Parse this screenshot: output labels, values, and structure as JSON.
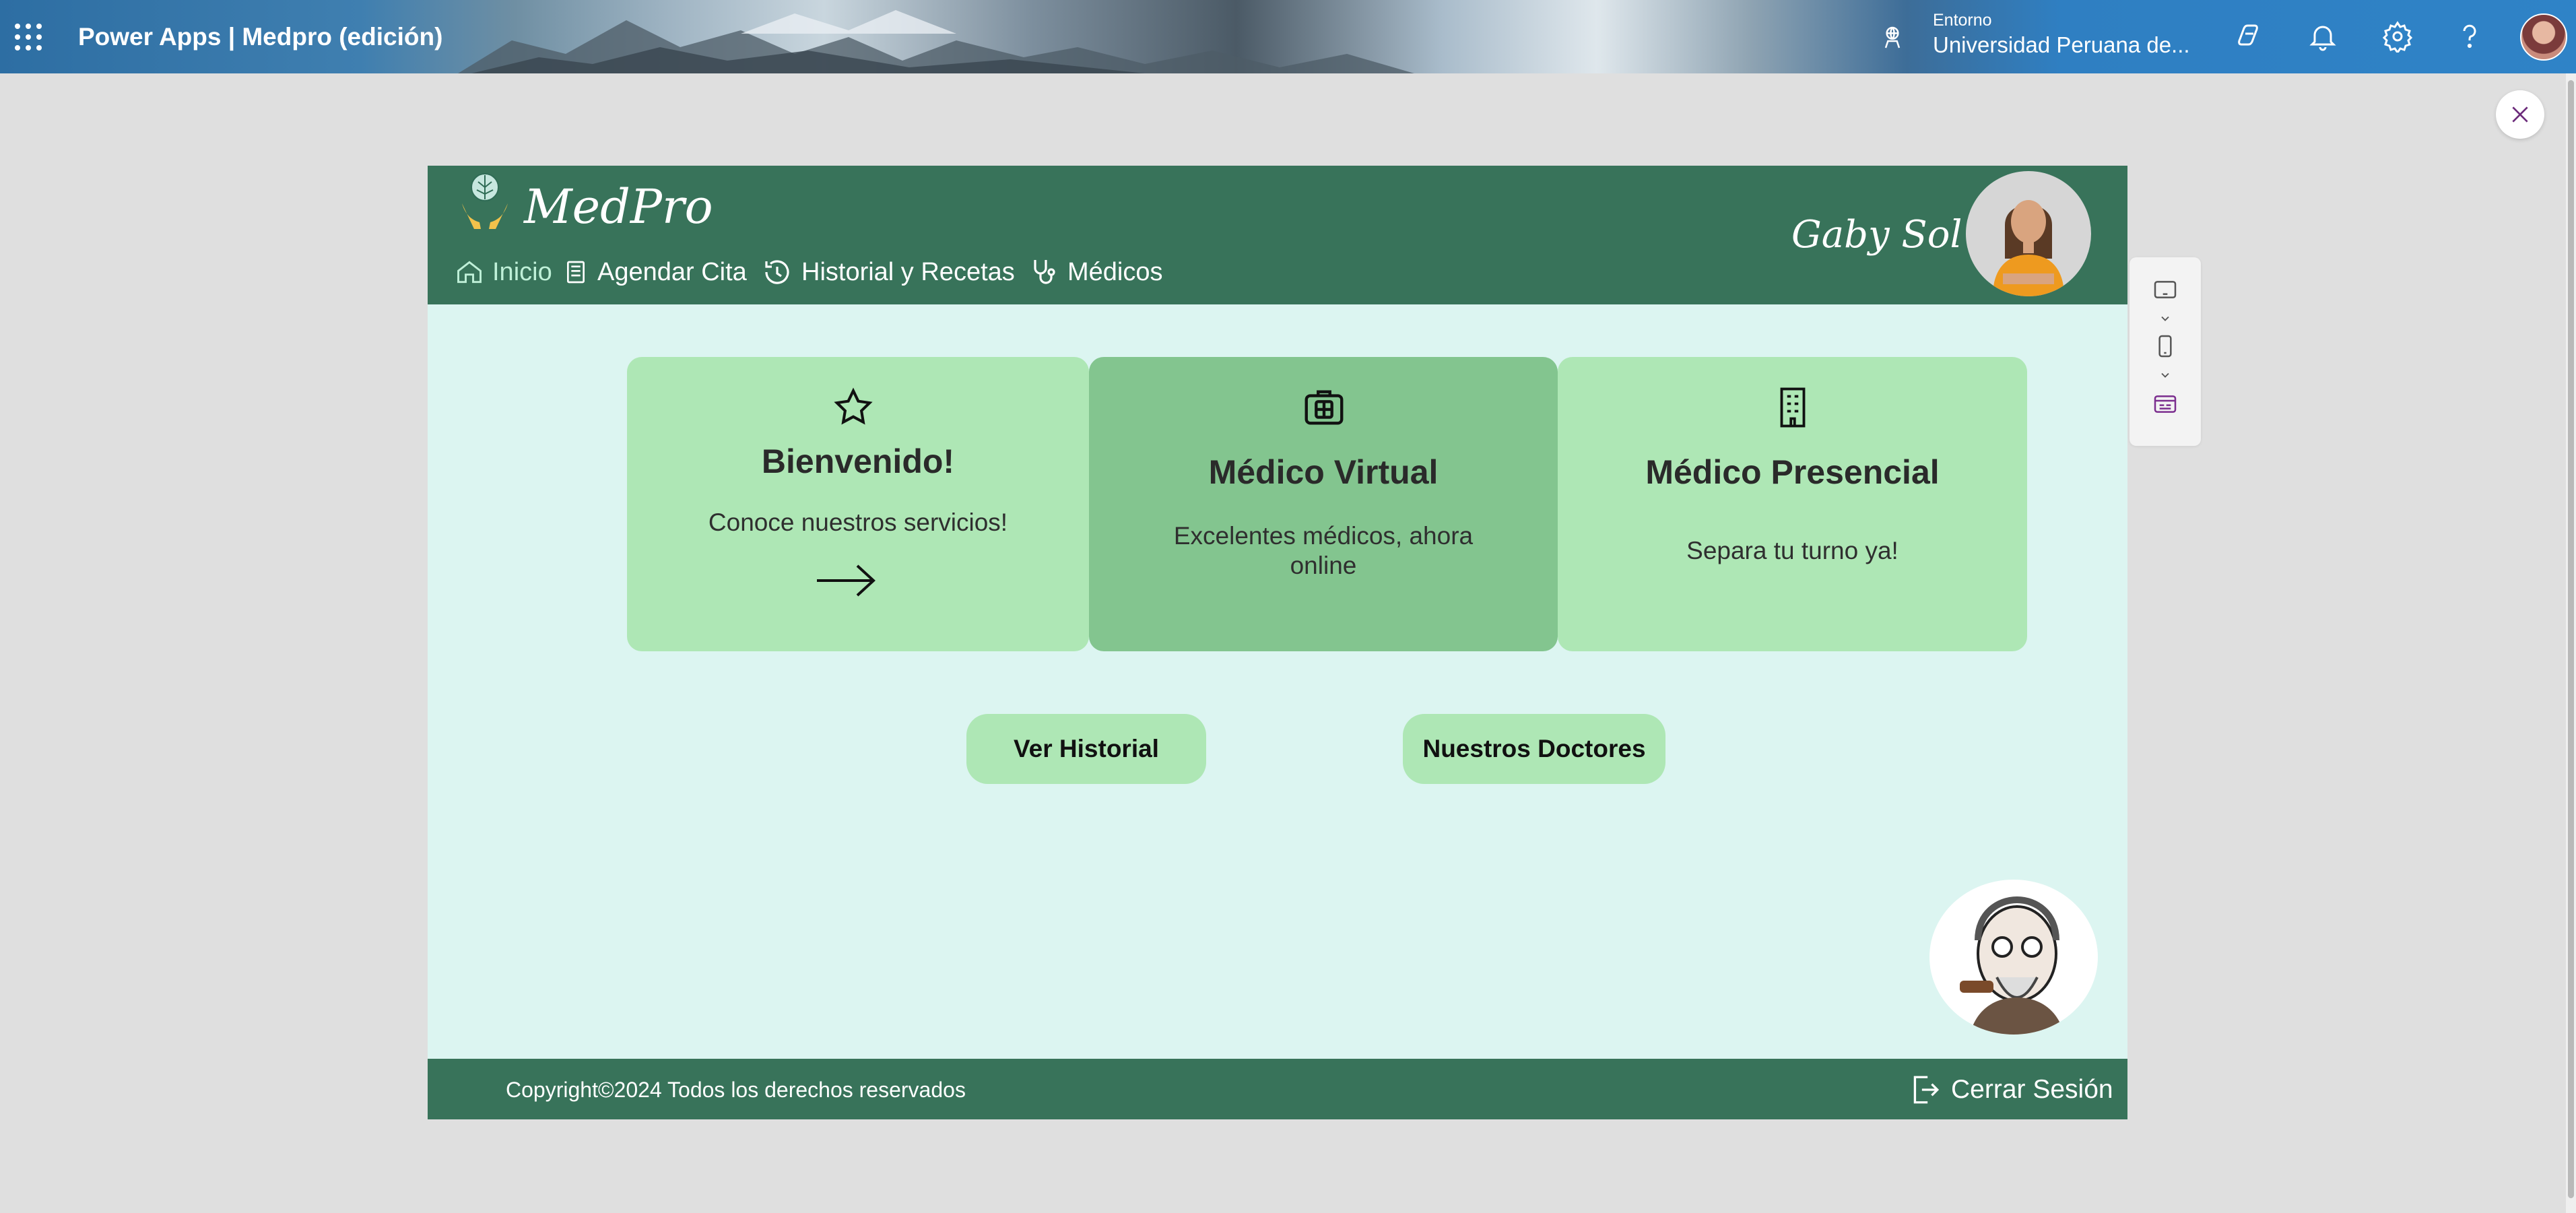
{
  "topbar": {
    "app_title": "Power Apps  |  Medpro (edición)",
    "environment_label": "Entorno",
    "environment_value": "Universidad Peruana de...",
    "icons": [
      "waffle-icon",
      "environment-icon",
      "copilot-icon",
      "bell-icon",
      "gear-icon",
      "help-icon",
      "user-avatar"
    ]
  },
  "app": {
    "brand": "MedPro",
    "user_name": "Gaby Sol",
    "nav": [
      {
        "label": "Inicio",
        "icon": "home-icon",
        "active": true
      },
      {
        "label": "Agendar Cita",
        "icon": "document-icon"
      },
      {
        "label": "Historial y Recetas",
        "icon": "history-icon"
      },
      {
        "label": "Médicos",
        "icon": "stethoscope-icon"
      }
    ],
    "cards": [
      {
        "title": "Bienvenido!",
        "subtitle": "Conoce nuestros servicios!",
        "icon": "star-icon"
      },
      {
        "title": "Médico Virtual",
        "subtitle": "Excelentes médicos, ahora online",
        "icon": "medical-kit-icon"
      },
      {
        "title": "Médico Presencial",
        "subtitle": "Separa tu turno ya!",
        "icon": "building-icon"
      }
    ],
    "buttons": {
      "history": "Ver Historial",
      "doctors": "Nuestros Doctores"
    },
    "footer": {
      "copyright": "Copyright©2024 Todos los derechos reservados",
      "logout": "Cerrar Sesión"
    }
  },
  "colors": {
    "header_green": "#38735a",
    "canvas_bg": "#dcf5f1",
    "card_light": "#aee7b5",
    "card_dark": "#83c58f"
  }
}
